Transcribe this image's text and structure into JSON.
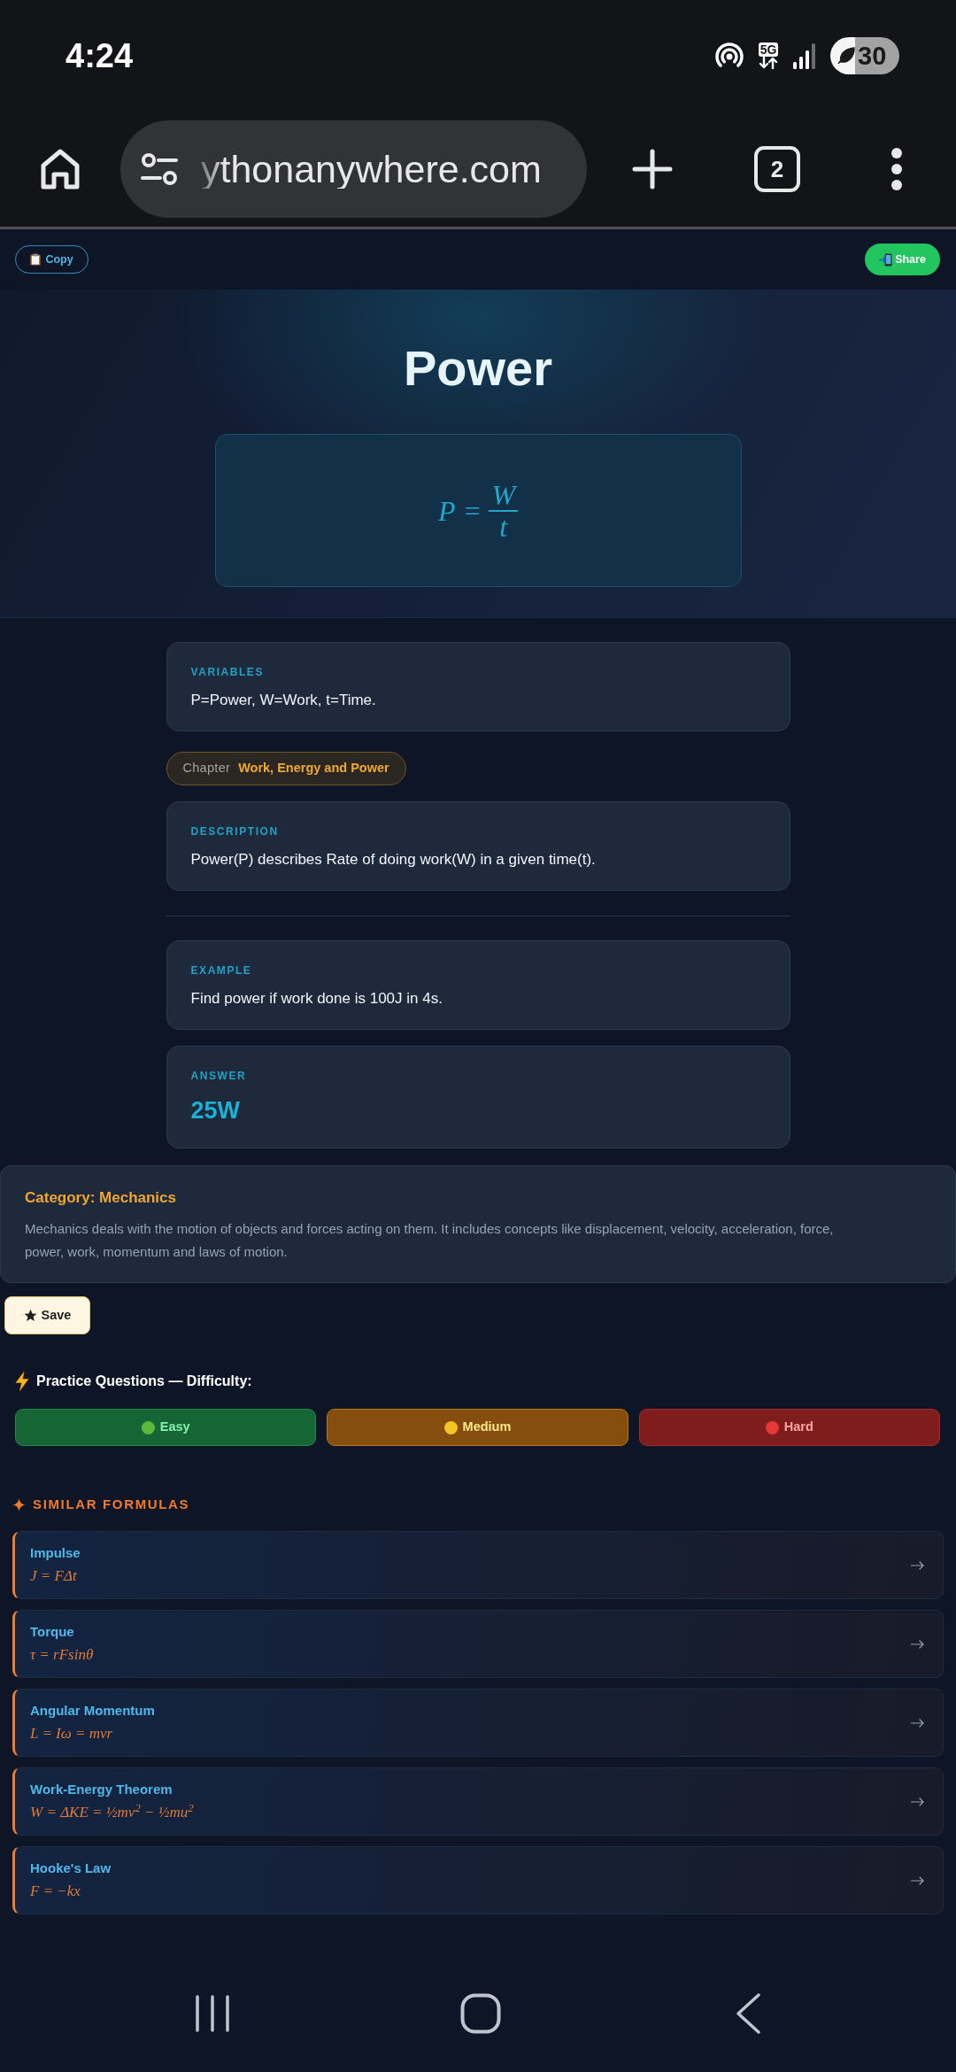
{
  "status_bar": {
    "time": "4:24",
    "network": "5G",
    "battery": "30"
  },
  "browser": {
    "url": "ythonanywhere.com",
    "tab_count": "2"
  },
  "toolbar": {
    "copy": "Copy",
    "share": "Share"
  },
  "hero": {
    "title": "Power",
    "formula": {
      "lhs": "P",
      "relation": "=",
      "numerator": "W",
      "denominator": "t"
    }
  },
  "sections": [
    {
      "kind": "text",
      "label": "VARIABLES",
      "text": "P=Power, W=Work, t=Time."
    },
    {
      "kind": "chapter",
      "label": "Chapter",
      "text": "Work, Energy and Power"
    },
    {
      "kind": "text",
      "label": "DESCRIPTION",
      "text": "Power(P) describes Rate of doing work(W) in a given time(t)."
    },
    {
      "kind": "divider"
    },
    {
      "kind": "text",
      "label": "EXAMPLE",
      "text": "Find power if work done is 100J in 4s."
    },
    {
      "kind": "answer",
      "label": "ANSWER",
      "text": "25W"
    }
  ],
  "category": {
    "title": "Category: Mechanics",
    "text": "Mechanics deals with the motion of objects and forces acting on them. It includes concepts like displacement, velocity, acceleration, force, power, work, momentum and laws of motion."
  },
  "save": {
    "label": "Save"
  },
  "practice": {
    "heading": "Practice Questions — Difficulty:",
    "levels": [
      {
        "kind": "easy",
        "label": "Easy",
        "color": "#5cb83a"
      },
      {
        "kind": "medium",
        "label": "Medium",
        "color": "#f6c325"
      },
      {
        "kind": "hard",
        "label": "Hard",
        "color": "#e53935"
      }
    ]
  },
  "similar": {
    "heading": "SIMILAR FORMULAS",
    "items": [
      {
        "title": "Impulse",
        "formula": "J = FΔt"
      },
      {
        "title": "Torque",
        "formula": "τ = rFsinθ"
      },
      {
        "title": "Angular Momentum",
        "formula": "L = Iω = mvr"
      },
      {
        "title": "Work-Energy Theorem",
        "formula": "W = ΔKE = ½mv$^{2}$ − ½mu$^{2}$"
      },
      {
        "title": "Hooke's Law",
        "formula": "F = −kx"
      }
    ]
  }
}
